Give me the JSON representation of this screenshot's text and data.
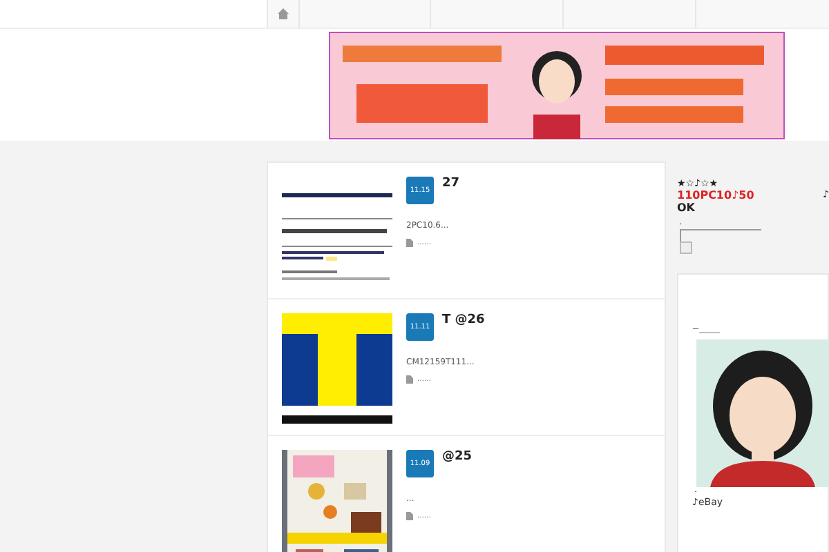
{
  "nav": {
    "items": [
      {
        "kind": "home",
        "selected": false
      },
      {
        "kind": "blank",
        "selected": false
      },
      {
        "kind": "blank",
        "selected": false
      },
      {
        "kind": "blank",
        "selected": false
      },
      {
        "kind": "blank",
        "selected": false
      }
    ]
  },
  "posts": [
    {
      "kind": "screen",
      "date": "11.15",
      "title": "27",
      "excerpt": "2PC10.6...",
      "link": "……"
    },
    {
      "kind": "logo",
      "date": "11.11",
      "title": "T @26",
      "excerpt": "CM12159T111...",
      "link": "……"
    },
    {
      "kind": "book",
      "date": "11.09",
      "title": "@25",
      "excerpt": "...",
      "link": "……"
    }
  ],
  "sidebar": {
    "stars": "★☆♪☆★",
    "headline": "110PC10♪50",
    "ok": "OK",
    "note": "♪",
    "bullet": "・",
    "profile_link": "ー______",
    "bullet_2": "・",
    "caption": "♪eBay"
  }
}
